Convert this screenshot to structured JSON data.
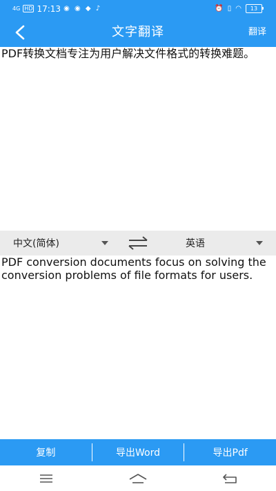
{
  "status_bar": {
    "network": "4G",
    "hd": "HD",
    "time": "17:13",
    "battery": "13"
  },
  "app_bar": {
    "title": "文字翻译",
    "translate_label": "翻译"
  },
  "source": {
    "text": "PDF转换文档专注为用户解决文件格式的转换难题。"
  },
  "language_bar": {
    "source_language": "中文(简体)",
    "target_language": "英语"
  },
  "target": {
    "text": "PDF conversion documents focus on solving the conversion problems of file formats for users."
  },
  "bottom_bar": {
    "copy_label": "复制",
    "export_word_label": "导出Word",
    "export_pdf_label": "导出Pdf"
  },
  "colors": {
    "primary": "#2b9af3",
    "lang_bar_bg": "#ebebeb"
  },
  "icons": [
    "back-arrow-icon",
    "swap-icon",
    "dropdown-caret-icon",
    "menu-icon",
    "home-icon",
    "back-nav-icon"
  ]
}
